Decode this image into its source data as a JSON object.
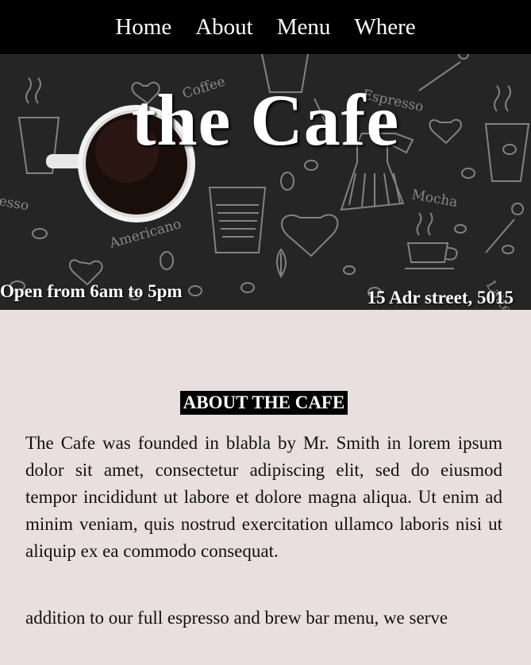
{
  "nav": {
    "items": [
      {
        "label": "Home"
      },
      {
        "label": "About"
      },
      {
        "label": "Menu"
      },
      {
        "label": "Where"
      }
    ]
  },
  "hero": {
    "title": "the Cafe",
    "hours": "Open from 6am to 5pm",
    "address": "15 Adr street, 5015",
    "doodle_words": [
      "Coffee",
      "Espresso",
      "Latte",
      "Mocha",
      "Americano",
      "esso"
    ]
  },
  "about": {
    "heading": "ABOUT THE CAFE",
    "paragraph": "The Cafe was founded in blabla by Mr. Smith in lorem ipsum dolor sit amet, consectetur adipiscing elit, sed do eiusmod tempor incididunt ut labore et dolore magna aliqua. Ut enim ad minim veniam, quis nostrud exercitation ullamco laboris nisi ut aliquip ex ea commodo consequat.",
    "paragraph2": "addition to our full espresso and brew bar menu, we serve"
  },
  "colors": {
    "nav_bg": "#000000",
    "hero_bg": "#252525",
    "page_bg": "#e9dfdf",
    "text": "#111111"
  }
}
